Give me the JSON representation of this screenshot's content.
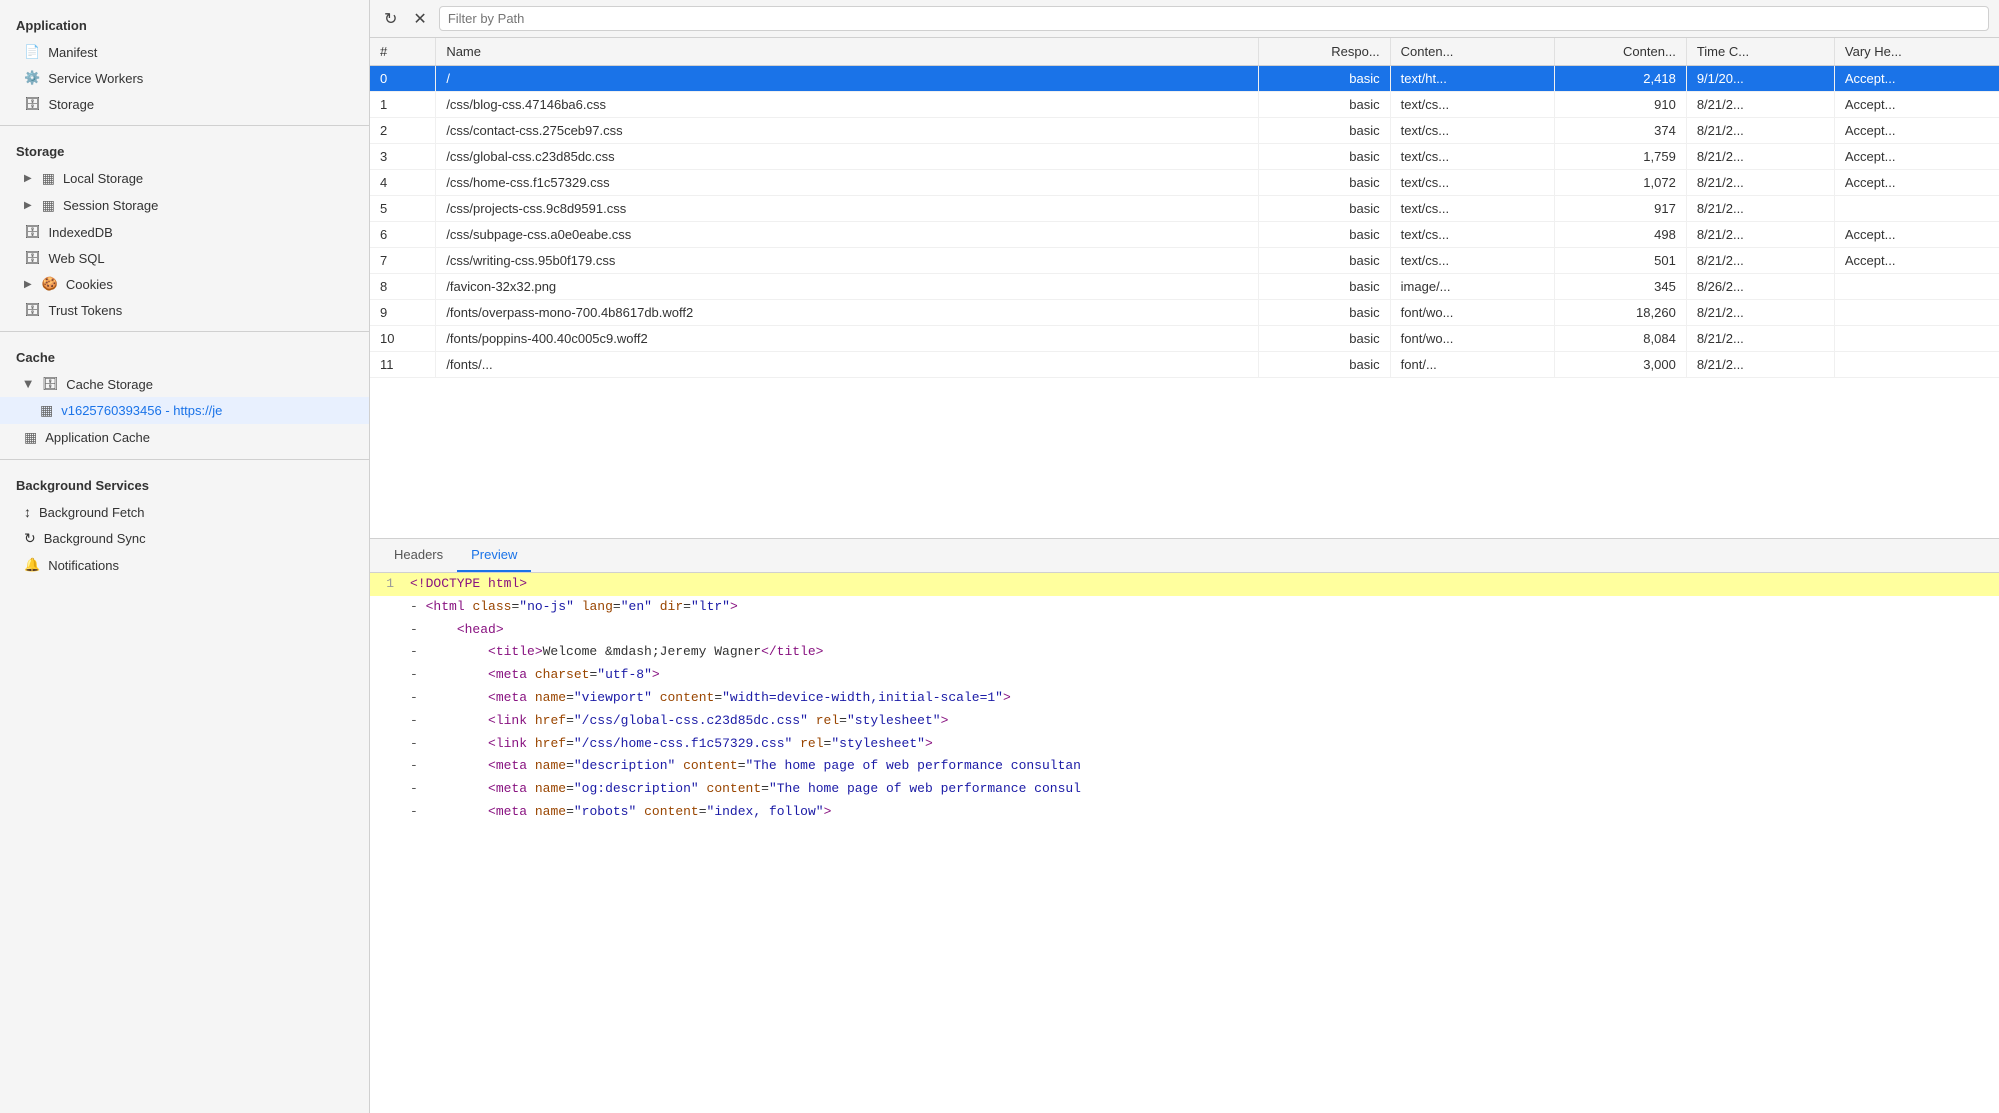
{
  "sidebar": {
    "sections": [
      {
        "label": "Application",
        "items": [
          {
            "id": "manifest",
            "label": "Manifest",
            "icon": "doc",
            "indent": 1
          },
          {
            "id": "service-workers",
            "label": "Service Workers",
            "icon": "gear",
            "indent": 1
          },
          {
            "id": "storage",
            "label": "Storage",
            "icon": "db",
            "indent": 1
          }
        ]
      },
      {
        "label": "Storage",
        "items": [
          {
            "id": "local-storage",
            "label": "Local Storage",
            "icon": "grid",
            "indent": 1,
            "expandable": true
          },
          {
            "id": "session-storage",
            "label": "Session Storage",
            "icon": "grid",
            "indent": 1,
            "expandable": true
          },
          {
            "id": "indexeddb",
            "label": "IndexedDB",
            "icon": "db",
            "indent": 1
          },
          {
            "id": "web-sql",
            "label": "Web SQL",
            "icon": "db",
            "indent": 1
          },
          {
            "id": "cookies",
            "label": "Cookies",
            "icon": "cookie",
            "indent": 1,
            "expandable": true
          },
          {
            "id": "trust-tokens",
            "label": "Trust Tokens",
            "icon": "db",
            "indent": 1
          }
        ]
      },
      {
        "label": "Cache",
        "items": [
          {
            "id": "cache-storage",
            "label": "Cache Storage",
            "icon": "cache",
            "indent": 1,
            "expandable": true,
            "expanded": true
          },
          {
            "id": "cache-storage-entry",
            "label": "v1625760393456 - https://je",
            "icon": "table",
            "indent": 2
          },
          {
            "id": "app-cache",
            "label": "Application Cache",
            "icon": "table",
            "indent": 1
          }
        ]
      },
      {
        "label": "Background Services",
        "items": [
          {
            "id": "bg-fetch",
            "label": "Background Fetch",
            "icon": "fetch",
            "indent": 1
          },
          {
            "id": "bg-sync",
            "label": "Background Sync",
            "icon": "sync",
            "indent": 1
          },
          {
            "id": "notifications",
            "label": "Notifications",
            "icon": "bell",
            "indent": 1
          }
        ]
      }
    ]
  },
  "toolbar": {
    "refresh_label": "↻",
    "clear_label": "✕",
    "filter_placeholder": "Filter by Path"
  },
  "table": {
    "columns": [
      "#",
      "Name",
      "Respo...",
      "Conten...",
      "Conten...",
      "Time C...",
      "Vary He..."
    ],
    "rows": [
      {
        "index": "0",
        "name": "/",
        "response": "basic",
        "content_type": "text/ht...",
        "content_len": "2,418",
        "time": "9/1/20...",
        "vary": "Accept...",
        "selected": true
      },
      {
        "index": "1",
        "name": "/css/blog-css.47146ba6.css",
        "response": "basic",
        "content_type": "text/cs...",
        "content_len": "910",
        "time": "8/21/2...",
        "vary": "Accept...",
        "selected": false
      },
      {
        "index": "2",
        "name": "/css/contact-css.275ceb97.css",
        "response": "basic",
        "content_type": "text/cs...",
        "content_len": "374",
        "time": "8/21/2...",
        "vary": "Accept...",
        "selected": false
      },
      {
        "index": "3",
        "name": "/css/global-css.c23d85dc.css",
        "response": "basic",
        "content_type": "text/cs...",
        "content_len": "1,759",
        "time": "8/21/2...",
        "vary": "Accept...",
        "selected": false
      },
      {
        "index": "4",
        "name": "/css/home-css.f1c57329.css",
        "response": "basic",
        "content_type": "text/cs...",
        "content_len": "1,072",
        "time": "8/21/2...",
        "vary": "Accept...",
        "selected": false
      },
      {
        "index": "5",
        "name": "/css/projects-css.9c8d9591.css",
        "response": "basic",
        "content_type": "text/cs...",
        "content_len": "917",
        "time": "8/21/2...",
        "vary": "",
        "selected": false
      },
      {
        "index": "6",
        "name": "/css/subpage-css.a0e0eabe.css",
        "response": "basic",
        "content_type": "text/cs...",
        "content_len": "498",
        "time": "8/21/2...",
        "vary": "Accept...",
        "selected": false
      },
      {
        "index": "7",
        "name": "/css/writing-css.95b0f179.css",
        "response": "basic",
        "content_type": "text/cs...",
        "content_len": "501",
        "time": "8/21/2...",
        "vary": "Accept...",
        "selected": false
      },
      {
        "index": "8",
        "name": "/favicon-32x32.png",
        "response": "basic",
        "content_type": "image/...",
        "content_len": "345",
        "time": "8/26/2...",
        "vary": "",
        "selected": false
      },
      {
        "index": "9",
        "name": "/fonts/overpass-mono-700.4b8617db.woff2",
        "response": "basic",
        "content_type": "font/wo...",
        "content_len": "18,260",
        "time": "8/21/2...",
        "vary": "",
        "selected": false
      },
      {
        "index": "10",
        "name": "/fonts/poppins-400.40c005c9.woff2",
        "response": "basic",
        "content_type": "font/wo...",
        "content_len": "8,084",
        "time": "8/21/2...",
        "vary": "",
        "selected": false
      },
      {
        "index": "11",
        "name": "/fonts/...",
        "response": "basic",
        "content_type": "font/...",
        "content_len": "3,000",
        "time": "8/21/2...",
        "vary": "",
        "selected": false
      }
    ]
  },
  "preview": {
    "tabs": [
      "Headers",
      "Preview"
    ],
    "active_tab": "Preview",
    "code_lines": [
      {
        "num": "1",
        "content": "<!DOCTYPE html>",
        "type": "doctype",
        "highlighted": true
      },
      {
        "num": "",
        "content": "- ",
        "extra": "<html class=\"no-js\" lang=\"en\" dir=\"ltr\">",
        "type": "tag"
      },
      {
        "num": "",
        "content": "-     ",
        "extra": "<head>",
        "type": "tag"
      },
      {
        "num": "",
        "content": "-         ",
        "extra": "<title>Welcome &mdash;Jeremy Wagner</title>",
        "type": "mixed"
      },
      {
        "num": "",
        "content": "-         ",
        "extra": "<meta charset=\"utf-8\">",
        "type": "tag"
      },
      {
        "num": "",
        "content": "-         ",
        "extra": "<meta name=\"viewport\" content=\"width=device-width,initial-scale=1\">",
        "type": "tag"
      },
      {
        "num": "",
        "content": "-         ",
        "extra": "<link href=\"/css/global-css.c23d85dc.css\" rel=\"stylesheet\">",
        "type": "tag"
      },
      {
        "num": "",
        "content": "-         ",
        "extra": "<link href=\"/css/home-css.f1c57329.css\" rel=\"stylesheet\">",
        "type": "tag"
      },
      {
        "num": "",
        "content": "-         ",
        "extra": "<meta name=\"description\" content=\"The home page of web performance consultan",
        "type": "tag"
      },
      {
        "num": "",
        "content": "-         ",
        "extra": "<meta name=\"og:description\" content=\"The home page of web performance consul",
        "type": "tag"
      },
      {
        "num": "",
        "content": "-         ",
        "extra": "<meta name=\"robots\" content=\"index, follow\">",
        "type": "tag"
      }
    ]
  }
}
